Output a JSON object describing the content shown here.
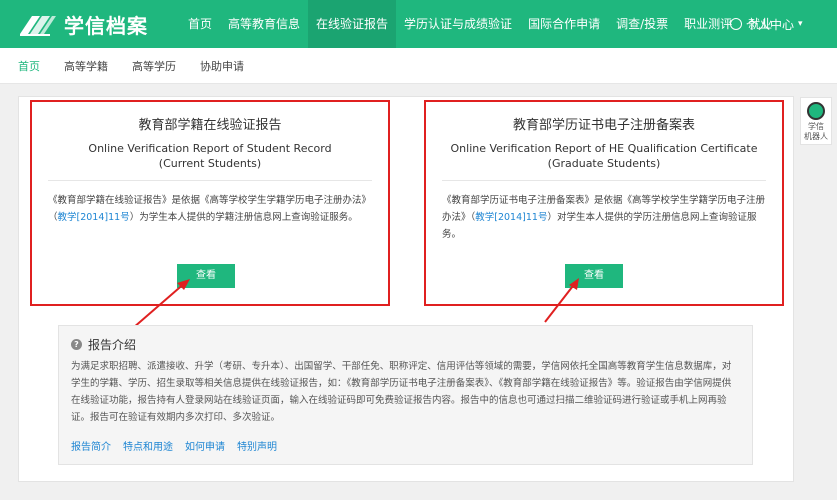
{
  "brand": {
    "name": "学信档案",
    "accent": "#1fb77e"
  },
  "topnav": {
    "items": [
      "首页",
      "高等教育信息",
      "在线验证报告",
      "学历认证与成绩验证",
      "国际合作申请",
      "调查/投票",
      "职业测评",
      "就业"
    ],
    "active_index": 2,
    "user_menu": "个人中心"
  },
  "subnav": {
    "items": [
      "首页",
      "高等学籍",
      "高等学历",
      "协助申请"
    ],
    "active_index": 0
  },
  "cards": [
    {
      "title": "教育部学籍在线验证报告",
      "en_line1": "Online Verification Report of Student Record",
      "en_line2": "(Current Students)",
      "desc_before": "《教育部学籍在线验证报告》是依据《高等学校学生学籍学历电子注册办法》（",
      "desc_link": "教学[2014]11号",
      "desc_after": "）为学生本人提供的学籍注册信息网上查询验证服务。",
      "button": "查看"
    },
    {
      "title": "教育部学历证书电子注册备案表",
      "en_line1": "Online Verification Report of HE Qualification Certificate",
      "en_line2": "(Graduate Students)",
      "desc_before": "《教育部学历证书电子注册备案表》是依据《高等学校学生学籍学历电子注册办法》（",
      "desc_link": "教学[2014]11号",
      "desc_after": "）对学生本人提供的学历注册信息网上查询验证服务。",
      "button": "查看"
    }
  ],
  "intro": {
    "title": "报告介绍",
    "body": "为满足求职招聘、派遣接收、升学（考研、专升本）、出国留学、干部任免、职称评定、信用评估等领域的需要，学信网依托全国高等教育学生信息数据库，对学生的学籍、学历、招生录取等相关信息提供在线验证报告，如：《教育部学历证书电子注册备案表》、《教育部学籍在线验证报告》等。验证报告由学信网提供在线验证功能，报告持有人登录网站在线验证页面，输入在线验证码即可免费验证报告内容。报告中的信息也可通过扫描二维验证码进行验证或手机上网再验证。报告可在验证有效期内多次打印、多次验证。",
    "links": [
      "报告简介",
      "特点和用途",
      "如何申请",
      "特别声明"
    ]
  },
  "robot": {
    "line1": "学信",
    "line2": "机器人"
  }
}
